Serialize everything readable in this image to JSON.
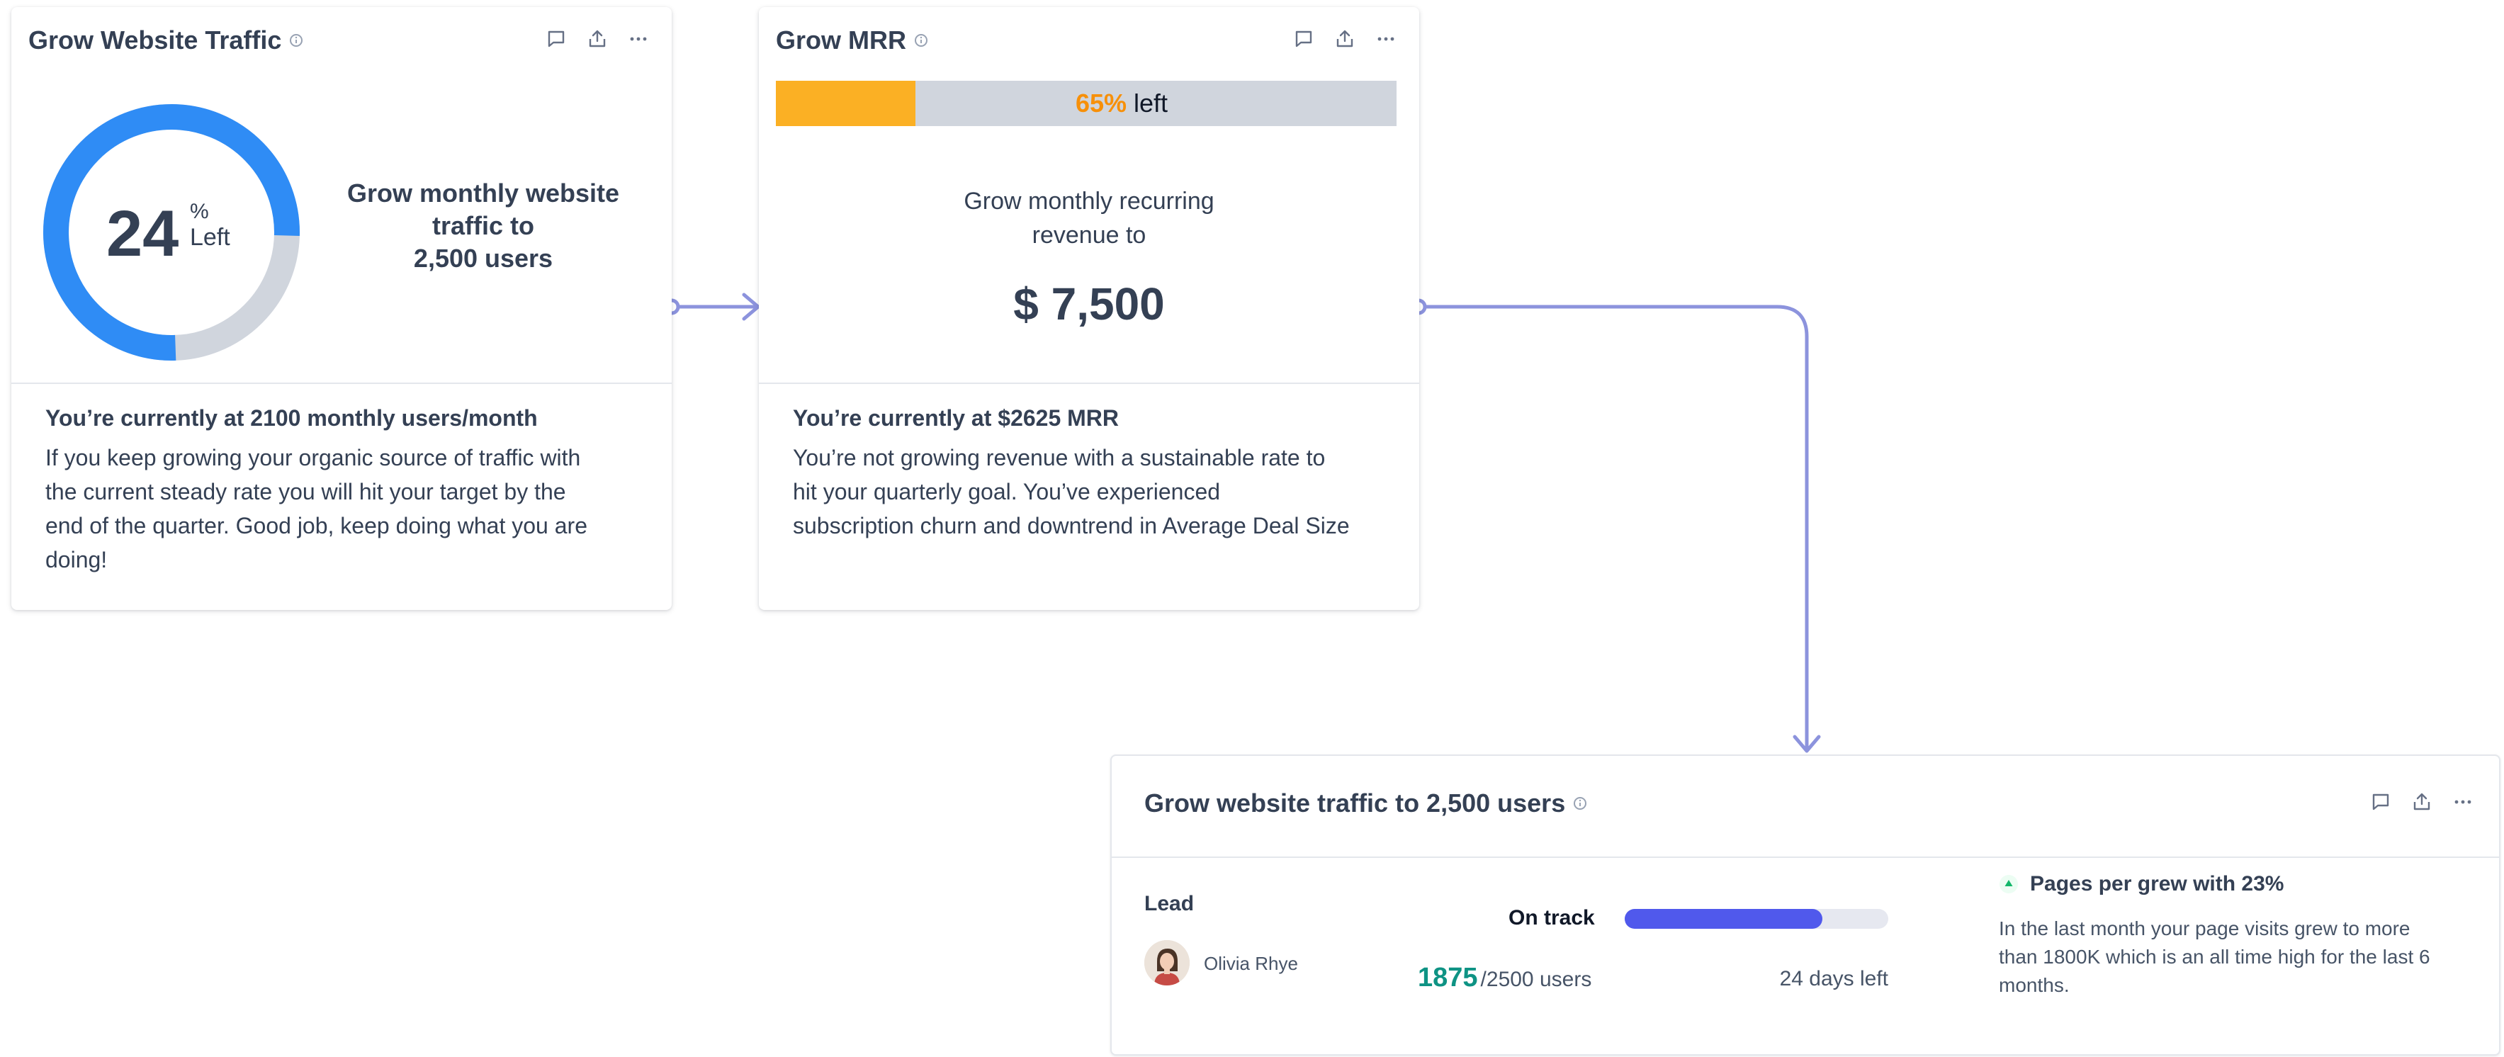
{
  "colors": {
    "connector": "#8c93dd",
    "donut_blue": "#2f8cf5",
    "donut_gray": "#d0d5dd",
    "bar_orange": "#fbb024",
    "bar_gray": "#d0d5dd",
    "percent_orange": "#f79009",
    "progress_blue": "#5059ec",
    "progress_track": "#e6e8f0",
    "value_teal": "#0e9384",
    "up_green": "#12b76a"
  },
  "icons": {
    "info": "info-icon",
    "comment": "comment-icon",
    "share": "share-icon",
    "more": "more-horizontal-icon",
    "trend_up": "triangle-up-icon"
  },
  "card1": {
    "title": "Grow Website Traffic",
    "donut": {
      "value": "24",
      "percent_sign": "%",
      "left_label": "Left",
      "filled_fraction": 0.76
    },
    "goal_lines": [
      "Grow monthly website",
      "traffic to",
      "2,500 users"
    ],
    "status_heading": "You’re currently at 2100 monthly users/month",
    "status_text_lines": [
      "If you keep growing your organic source of traffic with",
      "the current steady rate you will hit your target by the",
      "end of the quarter. Good job, keep doing what you are",
      "doing!"
    ]
  },
  "card2": {
    "title": "Grow MRR",
    "bar": {
      "percent": "65%",
      "left_label": "left",
      "filled_fraction": 0.225
    },
    "goal_lines": [
      "Grow monthly recurring",
      "revenue to"
    ],
    "amount": "$ 7,500",
    "status_heading": "You’re currently at $2625 MRR",
    "status_text_lines": [
      "You’re not growing revenue with a sustainable rate to",
      "hit your quarterly goal. You’ve experienced",
      "subscription churn and downtrend in Average Deal Size"
    ]
  },
  "card3": {
    "title": "Grow website traffic to 2,500 users",
    "lead_label": "Lead",
    "lead_name": "Olivia Rhye",
    "status_label": "On track",
    "progress_fraction": 0.75,
    "current_value": "1875",
    "target_text": "/2500 users",
    "days_left": "24 days left",
    "insight_heading": "Pages per grew with 23%",
    "insight_lines": [
      "In the last month your page visits grew to more",
      "than 1800K which is an all time high for the last 6",
      "months."
    ]
  }
}
